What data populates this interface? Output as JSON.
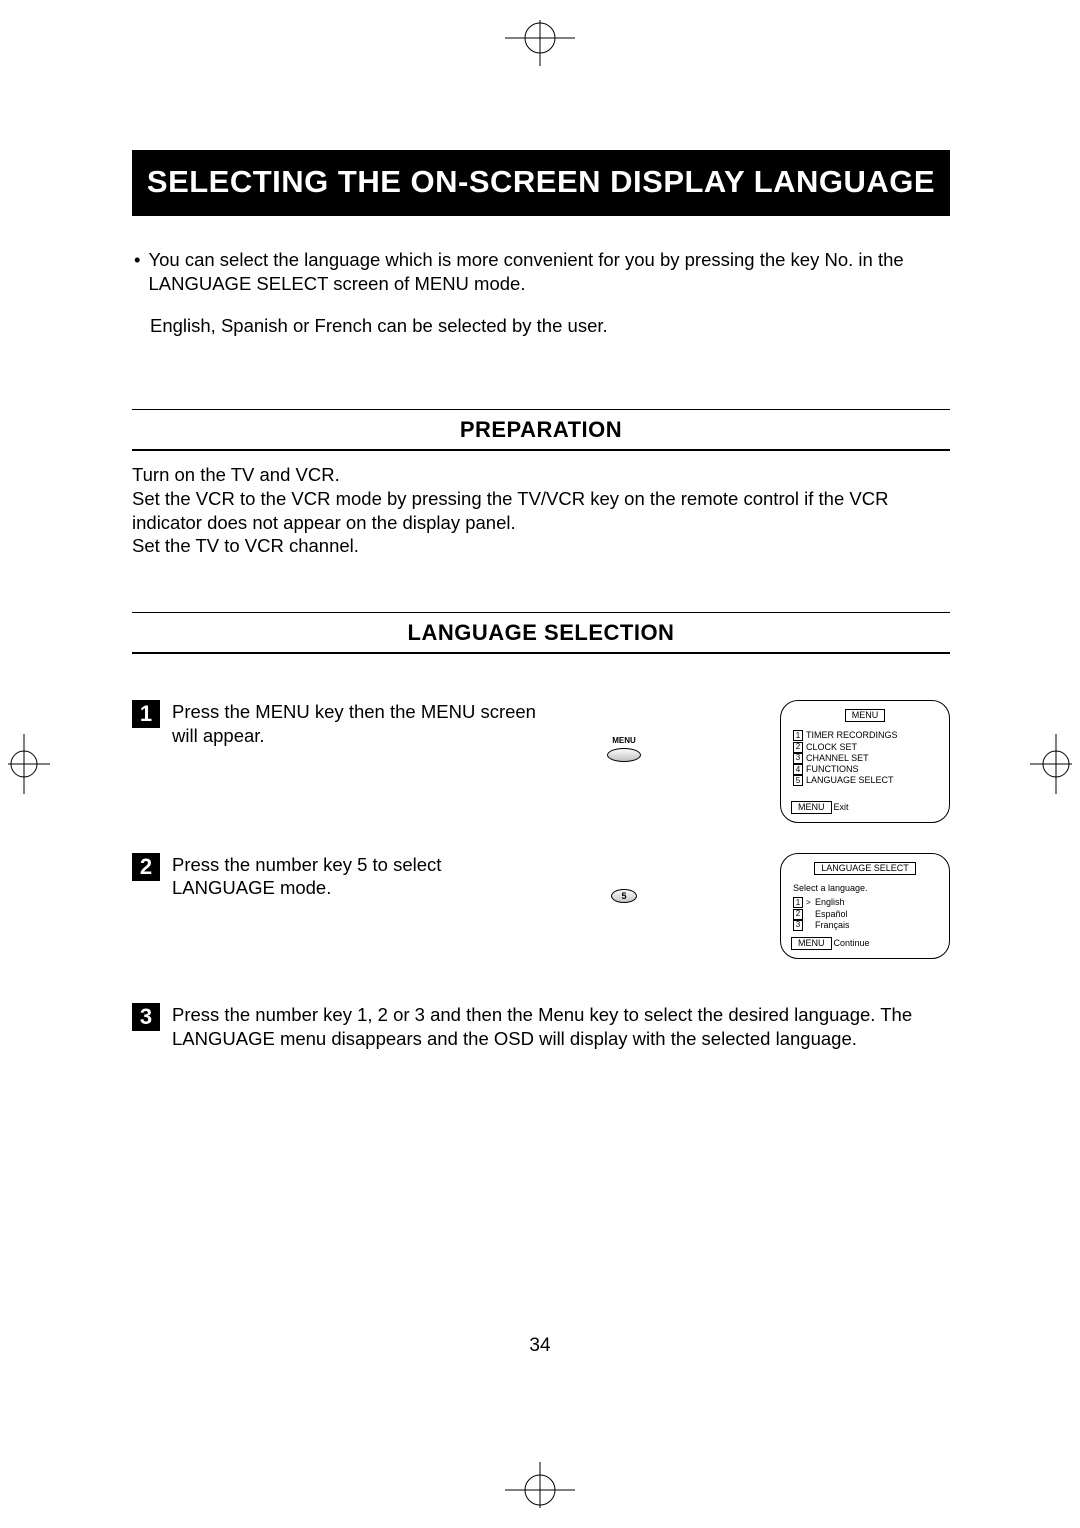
{
  "title": "SELECTING THE ON-SCREEN DISPLAY LANGUAGE",
  "intro": {
    "bullet": "•",
    "text": "You can select the language which is more convenient for you by pressing the key No. in the LANGUAGE SELECT screen of MENU mode.",
    "sub": "English, Spanish or French can be selected by the user."
  },
  "sections": {
    "preparation": {
      "heading": "PREPARATION",
      "lines": [
        "Turn on the TV and VCR.",
        "Set the VCR to the VCR mode by pressing the TV/VCR key on the remote control if the VCR indicator does not appear on the display panel.",
        "Set the TV to VCR channel."
      ]
    },
    "language_selection": {
      "heading": "LANGUAGE SELECTION",
      "steps": [
        {
          "num": "1",
          "text": "Press the MENU key then the MENU screen will appear.",
          "button_label": "MENU",
          "osd": {
            "title": "MENU",
            "items": [
              {
                "n": "1",
                "label": "TIMER RECORDINGS"
              },
              {
                "n": "2",
                "label": "CLOCK SET"
              },
              {
                "n": "3",
                "label": "CHANNEL SET"
              },
              {
                "n": "4",
                "label": "FUNCTIONS"
              },
              {
                "n": "5",
                "label": "LANGUAGE SELECT"
              }
            ],
            "footer_key": "MENU",
            "footer_label": "Exit"
          }
        },
        {
          "num": "2",
          "text": "Press the number key 5 to select LANGUAGE mode.",
          "button_number": "5",
          "osd": {
            "title": "LANGUAGE SELECT",
            "subtitle": "Select a language.",
            "items": [
              {
                "n": "1",
                "caret": ">",
                "label": "English"
              },
              {
                "n": "2",
                "caret": "",
                "label": "Español"
              },
              {
                "n": "3",
                "caret": "",
                "label": "Français"
              }
            ],
            "footer_key": "MENU",
            "footer_label": "Continue"
          }
        },
        {
          "num": "3",
          "text": "Press the number key 1, 2 or 3 and then the Menu key to select the desired language. The LANGUAGE  menu disappears and the OSD will display with the selected language."
        }
      ]
    }
  },
  "page_number": "34"
}
